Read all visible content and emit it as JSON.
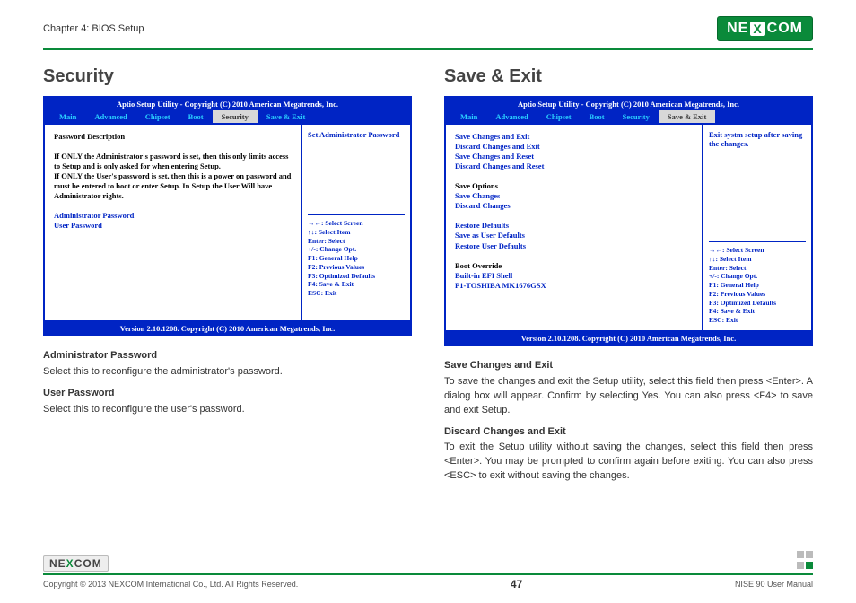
{
  "header": {
    "chapter": "Chapter 4: BIOS Setup",
    "brand": "NEXCOM"
  },
  "left": {
    "title": "Security",
    "bios": {
      "top": "Aptio Setup Utility - Copyright (C) 2010 American Megatrends, Inc.",
      "tabs": [
        "Main",
        "Advanced",
        "Chipset",
        "Boot",
        "Security",
        "Save & Exit"
      ],
      "activeTab": "Security",
      "bodyHeading": "Password Description",
      "body1": "If ONLY the Administrator's password is set, then this only limits access to Setup and is only asked for when entering Setup.",
      "body2": "If ONLY the User's password is set, then this is a power on password and must be entered to boot or enter Setup. In Setup the User Will have Administrator rights.",
      "blue1": "Administrator Password",
      "blue2": "User Password",
      "rightTop": "Set Administrator Password",
      "keys": {
        "k1": "→←: Select Screen",
        "k2": "↑↓: Select Item",
        "k3": "Enter: Select",
        "k4": "+/-: Change Opt.",
        "k5": "F1: General Help",
        "k6": "F2: Previous Values",
        "k7": "F3: Optimized Defaults",
        "k8": "F4: Save & Exit",
        "k9": "ESC: Exit"
      },
      "footer": "Version 2.10.1208. Copyright (C) 2010 American Megatrends, Inc."
    },
    "desc": {
      "h1": "Administrator Password",
      "p1": "Select this to reconfigure the administrator's password.",
      "h2": "User Password",
      "p2": "Select this to reconfigure the user's password."
    }
  },
  "right": {
    "title": "Save & Exit",
    "bios": {
      "top": "Aptio Setup Utility - Copyright (C) 2010 American Megatrends, Inc.",
      "tabs": [
        "Main",
        "Advanced",
        "Chipset",
        "Boot",
        "Security",
        "Save & Exit"
      ],
      "activeTab": "Save & Exit",
      "g1a": "Save Changes and Exit",
      "g1b": "Discard Changes and Exit",
      "g1c": "Save Changes and Reset",
      "g1d": "Discard Changes and Reset",
      "g2h": "Save Options",
      "g2a": "Save Changes",
      "g2b": "Discard Changes",
      "g3a": "Restore Defaults",
      "g3b": "Save as User Defaults",
      "g3c": "Restore User Defaults",
      "g4h": "Boot Override",
      "g4a": "Built-in EFI Shell",
      "g4b": "P1-TOSHIBA MK1676GSX",
      "rightTop": "Exit systm setup after saving the changes.",
      "keys": {
        "k1": "→←: Select Screen",
        "k2": "↑↓: Select Item",
        "k3": "Enter: Select",
        "k4": "+/-: Change Opt.",
        "k5": "F1: General Help",
        "k6": "F2: Previous Values",
        "k7": "F3: Optimized Defaults",
        "k8": "F4: Save & Exit",
        "k9": "ESC: Exit"
      },
      "footer": "Version 2.10.1208. Copyright (C) 2010 American Megatrends, Inc."
    },
    "desc": {
      "h1": "Save Changes and Exit",
      "p1": "To save the changes and exit the Setup utility, select this field then press <Enter>. A dialog box will appear. Confirm by selecting Yes. You can also press <F4> to save and exit Setup.",
      "h2": "Discard Changes and Exit",
      "p2": "To exit the Setup utility without saving the changes, select this field then press <Enter>. You may be prompted to confirm again before exiting. You can also press <ESC> to exit without saving the changes."
    }
  },
  "footer": {
    "copyright": "Copyright © 2013 NEXCOM International Co., Ltd. All Rights Reserved.",
    "page": "47",
    "manual": "NISE 90 User Manual"
  }
}
